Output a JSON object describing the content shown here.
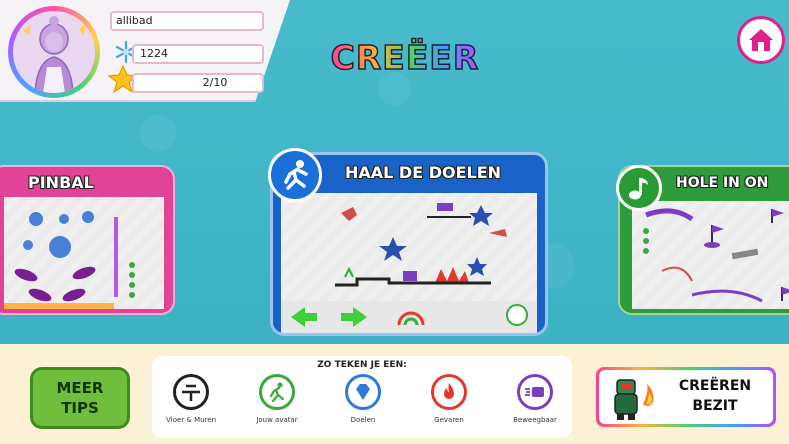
{
  "profile": {
    "username": "allibad",
    "snowflakes": "1224",
    "stars": "2/10"
  },
  "title": "CREËER",
  "cards": {
    "left": "PINBAL",
    "center": "HAAL DE DOELEN",
    "right": "HOLE IN ON"
  },
  "meer_tips": {
    "line1": "MEER",
    "line2": "TIPS"
  },
  "howto": {
    "title": "ZO TEKEN JE EEN:",
    "items": [
      {
        "label": "Vloer & Muren",
        "icon": "floor-wall-icon",
        "color": "#222222"
      },
      {
        "label": "Jouw avatar",
        "icon": "runner-icon",
        "color": "#3aa83a"
      },
      {
        "label": "Doelen",
        "icon": "diamond-icon",
        "color": "#2e7ad8"
      },
      {
        "label": "Gevaren",
        "icon": "fire-icon",
        "color": "#e23a2a"
      },
      {
        "label": "Beweegbaar",
        "icon": "moving-block-icon",
        "color": "#7a3fc0"
      }
    ]
  },
  "creeren": {
    "line1": "CREËREN",
    "line2": "BEZIT"
  },
  "colors": {
    "background": "#3fb2c6",
    "pinbal": "#e14397",
    "haal": "#1a63c6",
    "hole": "#2e9c3a",
    "home": "#e01f8c",
    "tips": "#6fbf3c"
  }
}
